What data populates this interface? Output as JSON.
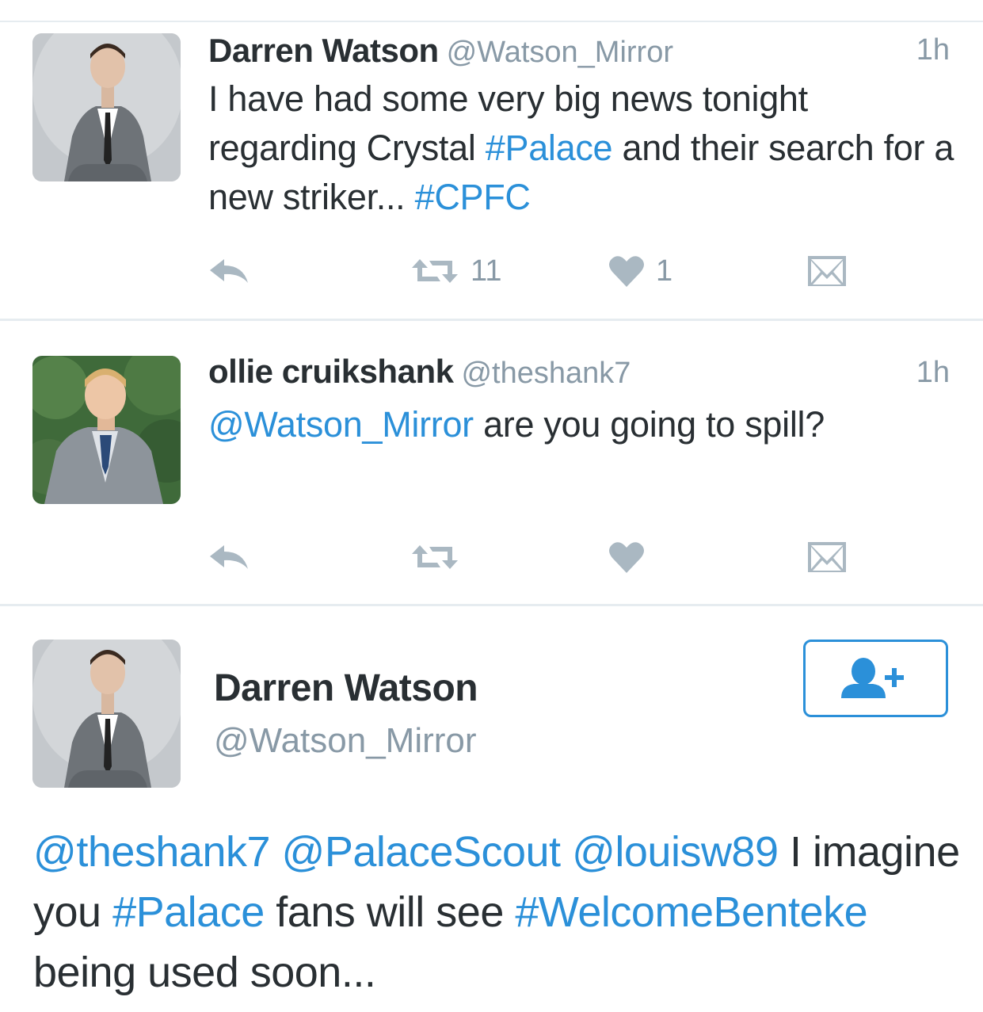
{
  "tweets": [
    {
      "name": "Darren Watson",
      "handle": "@Watson_Mirror",
      "time": "1h",
      "avatar_icon": "person-in-grey-suit-avatar",
      "text": [
        {
          "t": "I have had some very big news tonight regarding Crystal ",
          "link": false
        },
        {
          "t": "#Palace",
          "link": true
        },
        {
          "t": " and their search for a new striker... ",
          "link": false
        },
        {
          "t": "#CPFC",
          "link": true
        }
      ],
      "retweet_count": "11",
      "like_count": "1"
    },
    {
      "name": "ollie cruikshank",
      "handle": "@theshank7",
      "time": "1h",
      "avatar_icon": "person-in-grey-suit-outdoors-avatar",
      "text": [
        {
          "t": "@Watson_Mirror",
          "link": true
        },
        {
          "t": " are you going to spill?",
          "link": false
        }
      ],
      "retweet_count": "",
      "like_count": ""
    }
  ],
  "detail": {
    "name": "Darren Watson",
    "handle": "@Watson_Mirror",
    "avatar_icon": "person-in-grey-suit-avatar",
    "follow_icon": "add-user-icon",
    "text": [
      {
        "t": "@theshank7",
        "link": true
      },
      {
        "t": " ",
        "link": false
      },
      {
        "t": "@PalaceScout",
        "link": true
      },
      {
        "t": " ",
        "link": false
      },
      {
        "t": "@louisw89",
        "link": true
      },
      {
        "t": " I imagine you ",
        "link": false
      },
      {
        "t": "#Palace",
        "link": true
      },
      {
        "t": " fans will see ",
        "link": false
      },
      {
        "t": "#WelcomeBenteke",
        "link": true
      },
      {
        "t": " being used soon...",
        "link": false
      }
    ]
  },
  "colors": {
    "link": "#2b90d9",
    "muted": "#8899a6",
    "icon": "#aab8c2",
    "text": "#292f33",
    "divider": "#e6ecf0"
  }
}
